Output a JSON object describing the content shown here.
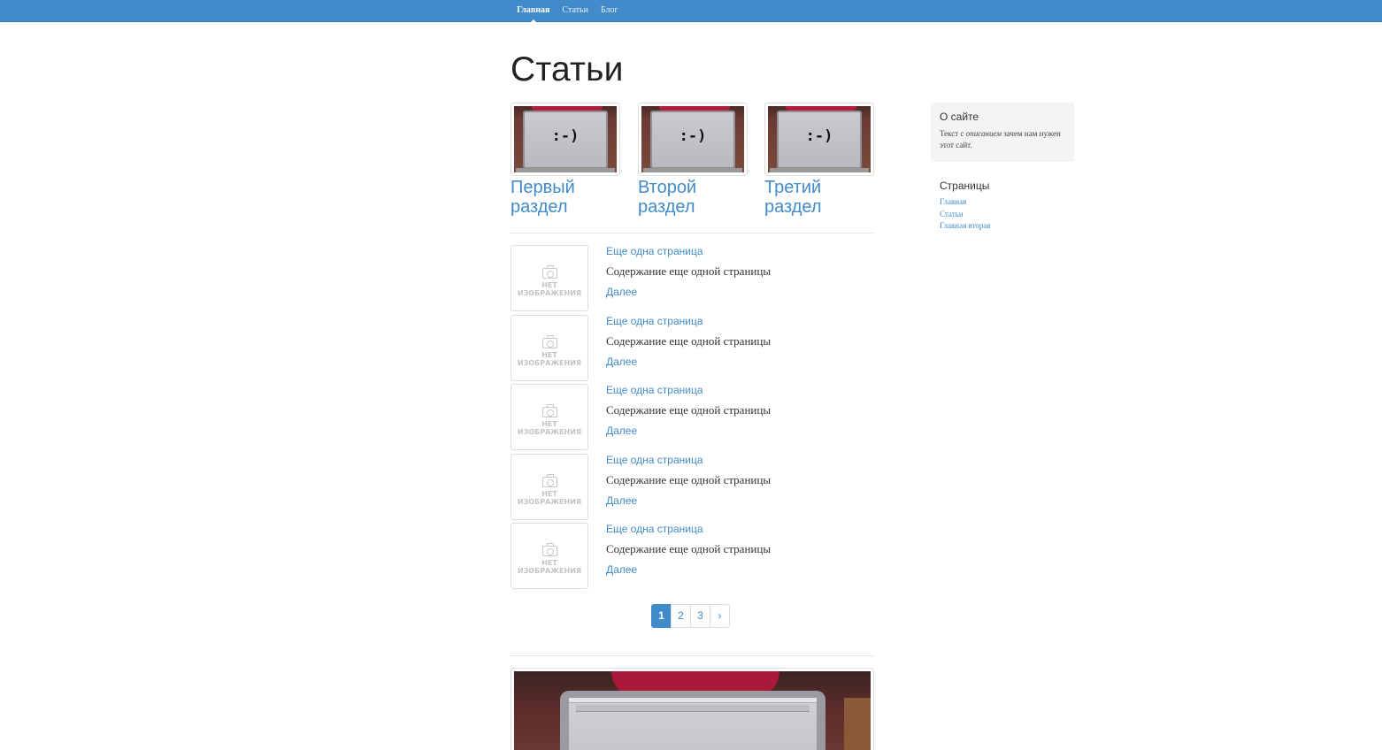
{
  "nav": {
    "items": [
      "Главная",
      "Статьи",
      "Блог"
    ],
    "active": 0
  },
  "page": {
    "title": "Статьи"
  },
  "sections": [
    {
      "title_line1": "Первый",
      "title_line2": "раздел",
      "image_text": ":-)"
    },
    {
      "title_line1": "Второй",
      "title_line2": "раздел",
      "image_text": ":-)"
    },
    {
      "title_line1": "Третий",
      "title_line2": "раздел",
      "image_text": ":-)"
    }
  ],
  "articles": [
    {
      "title": "Еще одна страница",
      "text": "Содержание еще одной страницы",
      "more": "Далее",
      "noimage_line1": "НЕТ",
      "noimage_line2": "ИЗОБРАЖЕНИЯ"
    },
    {
      "title": "Еще одна страница",
      "text": "Содержание еще одной страницы",
      "more": "Далее",
      "noimage_line1": "НЕТ",
      "noimage_line2": "ИЗОБРАЖЕНИЯ"
    },
    {
      "title": "Еще одна страница",
      "text": "Содержание еще одной страницы",
      "more": "Далее",
      "noimage_line1": "НЕТ",
      "noimage_line2": "ИЗОБРАЖЕНИЯ"
    },
    {
      "title": "Еще одна страница",
      "text": "Содержание еще одной страницы",
      "more": "Далее",
      "noimage_line1": "НЕТ",
      "noimage_line2": "ИЗОБРАЖЕНИЯ"
    },
    {
      "title": "Еще одна страница",
      "text": "Содержание еще одной страницы",
      "more": "Далее",
      "noimage_line1": "НЕТ",
      "noimage_line2": "ИЗОБРАЖЕНИЯ"
    }
  ],
  "pagination": {
    "pages": [
      "1",
      "2",
      "3"
    ],
    "next": "›",
    "current": "1"
  },
  "sidebar": {
    "about": {
      "title": "О сайте",
      "text_before": "Текст с ",
      "text_em": "описанием",
      "text_after": " зачем нам нужен этот сайт."
    },
    "pages": {
      "title": "Страницы",
      "links": [
        "Главная",
        "Статьи",
        "Главная вторая"
      ]
    }
  },
  "colors": {
    "accent": "#428bca",
    "topbar": "#428bca",
    "sidebar_bg": "#f4f4f4",
    "border": "#dddddd"
  }
}
